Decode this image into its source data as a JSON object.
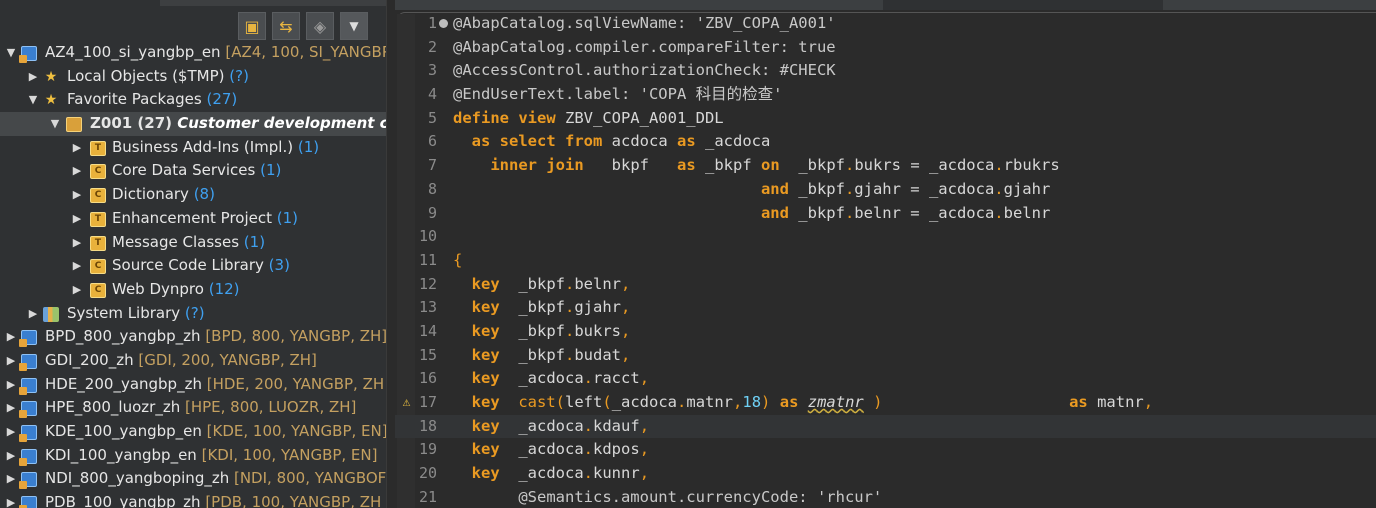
{
  "explorer": {
    "toolbar": {
      "collapse_icon": "collapse-all-icon",
      "link_icon": "link-with-editor-icon",
      "focus_icon": "focus-icon",
      "menu_icon": "view-menu-chevron-icon"
    },
    "tree": [
      {
        "depth": 0,
        "expanded": true,
        "icon": "sys",
        "text": "AZ4_100_si_yangbp_en",
        "detail": "[AZ4, 100, SI_YANGBP"
      },
      {
        "depth": 1,
        "expanded": false,
        "icon": "local",
        "text": "Local Objects ($TMP)",
        "count": "(?)"
      },
      {
        "depth": 1,
        "expanded": true,
        "icon": "local",
        "text": "Favorite Packages",
        "count": "(27)"
      },
      {
        "depth": 2,
        "expanded": true,
        "icon": "pkg",
        "text": "Z001 (27)",
        "desc": "Customer development clas",
        "selected": true
      },
      {
        "depth": 3,
        "expanded": false,
        "icon": "cat",
        "glyph": "T",
        "text": "Business Add-Ins (Impl.)",
        "count": "(1)"
      },
      {
        "depth": 3,
        "expanded": false,
        "icon": "cat",
        "glyph": "C",
        "text": "Core Data Services",
        "count": "(1)"
      },
      {
        "depth": 3,
        "expanded": false,
        "icon": "cat",
        "glyph": "C",
        "text": "Dictionary",
        "count": "(8)"
      },
      {
        "depth": 3,
        "expanded": false,
        "icon": "cat",
        "glyph": "T",
        "text": "Enhancement Project",
        "count": "(1)"
      },
      {
        "depth": 3,
        "expanded": false,
        "icon": "cat",
        "glyph": "T",
        "text": "Message Classes",
        "count": "(1)"
      },
      {
        "depth": 3,
        "expanded": false,
        "icon": "cat",
        "glyph": "C",
        "text": "Source Code Library",
        "count": "(3)"
      },
      {
        "depth": 3,
        "expanded": false,
        "icon": "cat",
        "glyph": "C",
        "text": "Web Dynpro",
        "count": "(12)"
      },
      {
        "depth": 1,
        "expanded": false,
        "icon": "lib",
        "text": "System Library",
        "count": "(?)"
      },
      {
        "depth": 0,
        "expanded": false,
        "icon": "sys",
        "text": "BPD_800_yangbp_zh",
        "detail": "[BPD, 800, YANGBP, ZH]"
      },
      {
        "depth": 0,
        "expanded": false,
        "icon": "sys",
        "text": "GDI_200_zh",
        "detail": "[GDI, 200, YANGBP, ZH]"
      },
      {
        "depth": 0,
        "expanded": false,
        "icon": "sys",
        "text": "HDE_200_yangbp_zh",
        "detail": "[HDE, 200, YANGBP, ZH"
      },
      {
        "depth": 0,
        "expanded": false,
        "icon": "sys",
        "text": "HPE_800_luozr_zh",
        "detail": "[HPE, 800, LUOZR, ZH]"
      },
      {
        "depth": 0,
        "expanded": false,
        "icon": "sys",
        "text": "KDE_100_yangbp_en",
        "detail": "[KDE, 100, YANGBP, EN]"
      },
      {
        "depth": 0,
        "expanded": false,
        "icon": "sys",
        "text": "KDI_100_yangbp_en",
        "detail": "[KDI, 100, YANGBP, EN]"
      },
      {
        "depth": 0,
        "expanded": false,
        "icon": "sys",
        "text": "NDI_800_yangboping_zh",
        "detail": "[NDI, 800, YANGBOF"
      },
      {
        "depth": 0,
        "expanded": false,
        "icon": "sys",
        "text": "PDB_100_yangbp_zh",
        "detail": "[PDB, 100, YANGBP, ZH"
      }
    ]
  },
  "editor": {
    "current_line": 18,
    "warning_line": 17,
    "lines": [
      {
        "n": "1",
        "fold": true,
        "t": [
          [
            "a",
            "@AbapCatalog.sqlViewName: 'ZBV_COPA_A001'"
          ]
        ]
      },
      {
        "n": "2",
        "t": [
          [
            "a",
            "@AbapCatalog.compiler.compareFilter: true"
          ]
        ]
      },
      {
        "n": "3",
        "t": [
          [
            "a",
            "@AccessControl.authorizationCheck: #CHECK"
          ]
        ]
      },
      {
        "n": "4",
        "t": [
          [
            "a",
            "@EndUserText.label: 'COPA 科目的检查'"
          ]
        ]
      },
      {
        "n": "5",
        "t": [
          [
            "k",
            "define view"
          ],
          [
            "s",
            " ZBV_COPA_A001_DDL"
          ]
        ]
      },
      {
        "n": "6",
        "t": [
          [
            "s",
            "  "
          ],
          [
            "k",
            "as select from"
          ],
          [
            "s",
            " acdoca "
          ],
          [
            "k",
            "as"
          ],
          [
            "s",
            " _acdoca"
          ]
        ]
      },
      {
        "n": "7",
        "t": [
          [
            "s",
            "    "
          ],
          [
            "k",
            "inner join"
          ],
          [
            "s",
            "   bkpf   "
          ],
          [
            "k",
            "as"
          ],
          [
            "s",
            " _bkpf "
          ],
          [
            "k",
            "on"
          ],
          [
            "s",
            "  _bkpf"
          ],
          [
            "p",
            "."
          ],
          [
            "s",
            "bukrs = _acdoca"
          ],
          [
            "p",
            "."
          ],
          [
            "s",
            "rbukrs"
          ]
        ]
      },
      {
        "n": "8",
        "t": [
          [
            "s",
            "                                 "
          ],
          [
            "k",
            "and"
          ],
          [
            "s",
            " _bkpf"
          ],
          [
            "p",
            "."
          ],
          [
            "s",
            "gjahr = _acdoca"
          ],
          [
            "p",
            "."
          ],
          [
            "s",
            "gjahr"
          ]
        ]
      },
      {
        "n": "9",
        "t": [
          [
            "s",
            "                                 "
          ],
          [
            "k",
            "and"
          ],
          [
            "s",
            " _bkpf"
          ],
          [
            "p",
            "."
          ],
          [
            "s",
            "belnr = _acdoca"
          ],
          [
            "p",
            "."
          ],
          [
            "s",
            "belnr"
          ]
        ]
      },
      {
        "n": "10",
        "t": []
      },
      {
        "n": "11",
        "t": [
          [
            "p",
            "{"
          ]
        ]
      },
      {
        "n": "12",
        "t": [
          [
            "s",
            "  "
          ],
          [
            "k",
            "key"
          ],
          [
            "s",
            "  _bkpf"
          ],
          [
            "p",
            "."
          ],
          [
            "s",
            "belnr"
          ],
          [
            "p",
            ","
          ]
        ]
      },
      {
        "n": "13",
        "t": [
          [
            "s",
            "  "
          ],
          [
            "k",
            "key"
          ],
          [
            "s",
            "  _bkpf"
          ],
          [
            "p",
            "."
          ],
          [
            "s",
            "gjahr"
          ],
          [
            "p",
            ","
          ]
        ]
      },
      {
        "n": "14",
        "t": [
          [
            "s",
            "  "
          ],
          [
            "k",
            "key"
          ],
          [
            "s",
            "  _bkpf"
          ],
          [
            "p",
            "."
          ],
          [
            "s",
            "bukrs"
          ],
          [
            "p",
            ","
          ]
        ]
      },
      {
        "n": "15",
        "t": [
          [
            "s",
            "  "
          ],
          [
            "k",
            "key"
          ],
          [
            "s",
            "  _bkpf"
          ],
          [
            "p",
            "."
          ],
          [
            "s",
            "budat"
          ],
          [
            "p",
            ","
          ]
        ]
      },
      {
        "n": "16",
        "t": [
          [
            "s",
            "  "
          ],
          [
            "k",
            "key"
          ],
          [
            "s",
            "  _acdoca"
          ],
          [
            "p",
            "."
          ],
          [
            "s",
            "racct"
          ],
          [
            "p",
            ","
          ]
        ]
      },
      {
        "n": "17",
        "t": [
          [
            "s",
            "  "
          ],
          [
            "k",
            "key"
          ],
          [
            "s",
            "  "
          ],
          [
            "p",
            "cast("
          ],
          [
            "s",
            "left"
          ],
          [
            "p",
            "("
          ],
          [
            "s",
            "_acdoca"
          ],
          [
            "p",
            "."
          ],
          [
            "s",
            "matnr"
          ],
          [
            "p",
            ","
          ],
          [
            "n",
            "18"
          ],
          [
            "p",
            ")"
          ],
          [
            "s",
            " "
          ],
          [
            "k",
            "as"
          ],
          [
            "s",
            " "
          ],
          [
            "u",
            "zmatnr"
          ],
          [
            "s",
            " "
          ],
          [
            "p",
            ")"
          ],
          [
            "s",
            "                    "
          ],
          [
            "k",
            "as"
          ],
          [
            "s",
            " matnr"
          ],
          [
            "p",
            ","
          ]
        ]
      },
      {
        "n": "18",
        "t": [
          [
            "s",
            "  "
          ],
          [
            "k",
            "key"
          ],
          [
            "s",
            "  _acdoca"
          ],
          [
            "p",
            "."
          ],
          [
            "s",
            "kdauf"
          ],
          [
            "p",
            ","
          ]
        ]
      },
      {
        "n": "19",
        "t": [
          [
            "s",
            "  "
          ],
          [
            "k",
            "key"
          ],
          [
            "s",
            "  _acdoca"
          ],
          [
            "p",
            "."
          ],
          [
            "s",
            "kdpos"
          ],
          [
            "p",
            ","
          ]
        ]
      },
      {
        "n": "20",
        "t": [
          [
            "s",
            "  "
          ],
          [
            "k",
            "key"
          ],
          [
            "s",
            "  _acdoca"
          ],
          [
            "p",
            "."
          ],
          [
            "s",
            "kunnr"
          ],
          [
            "p",
            ","
          ]
        ]
      },
      {
        "n": "21",
        "t": [
          [
            "s",
            "       "
          ],
          [
            "a",
            "@Semantics.amount.currencyCode: 'rhcur'"
          ]
        ]
      }
    ]
  }
}
